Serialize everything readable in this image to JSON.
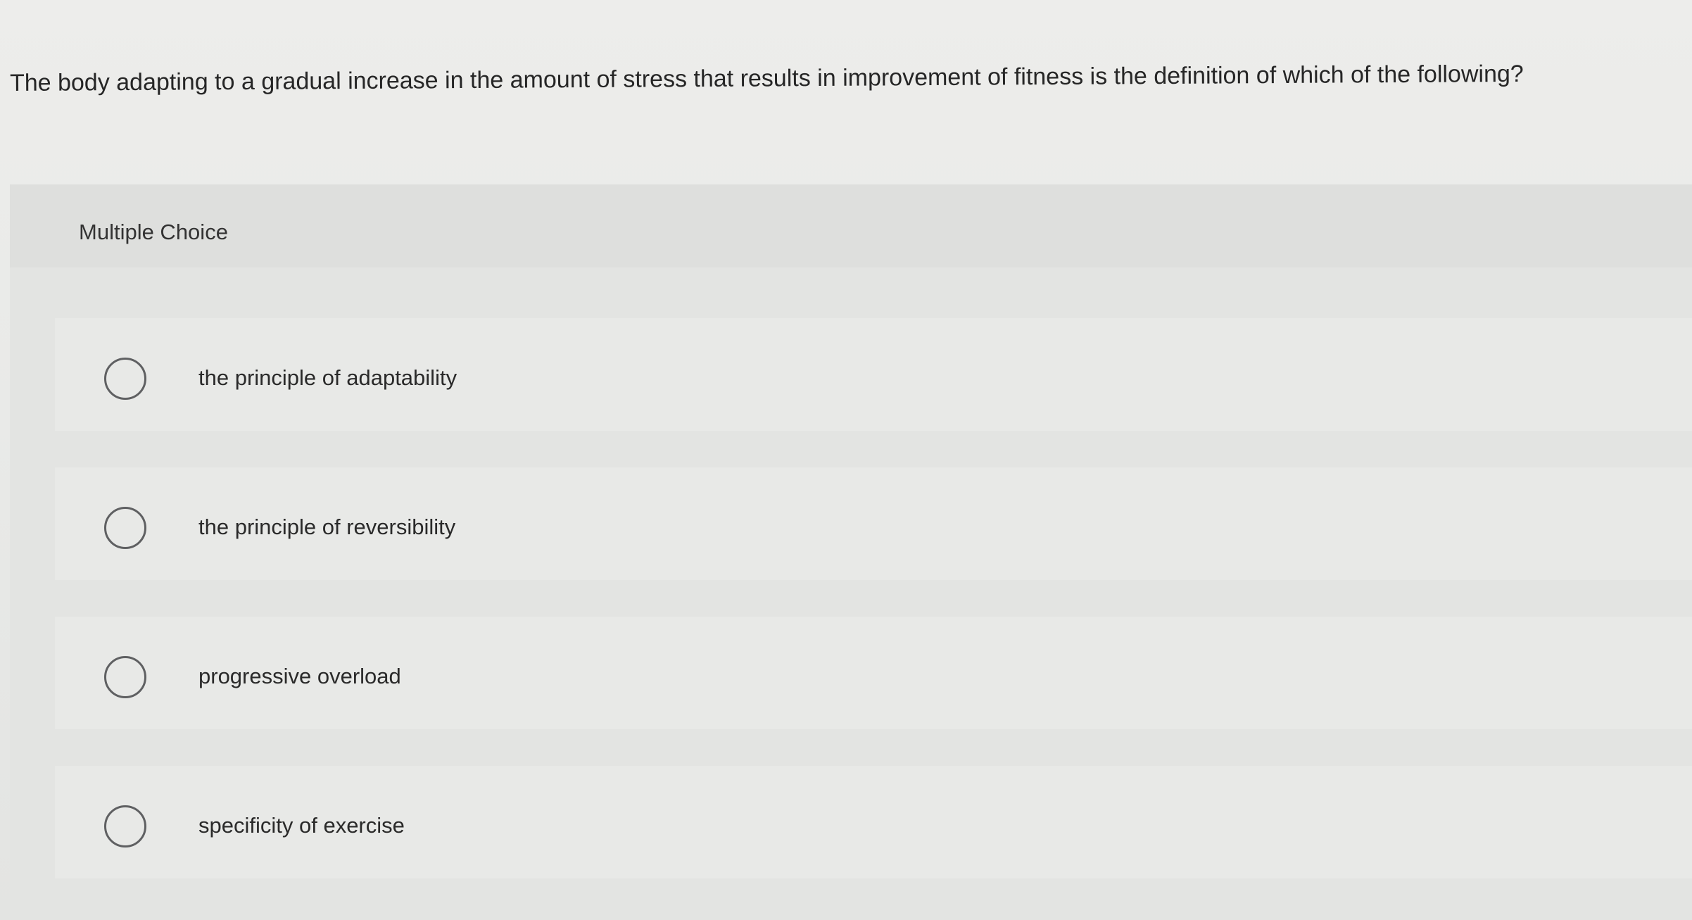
{
  "question": {
    "text": "The body adapting to a gradual increase in the amount of stress that results in improvement of fitness is the definition of which of the following?"
  },
  "panel": {
    "title": "Multiple Choice"
  },
  "options": [
    {
      "label": "the principle of adaptability",
      "selected": false
    },
    {
      "label": "the principle of reversibility",
      "selected": false
    },
    {
      "label": "progressive overload",
      "selected": false
    },
    {
      "label": "specificity of exercise",
      "selected": false
    }
  ]
}
